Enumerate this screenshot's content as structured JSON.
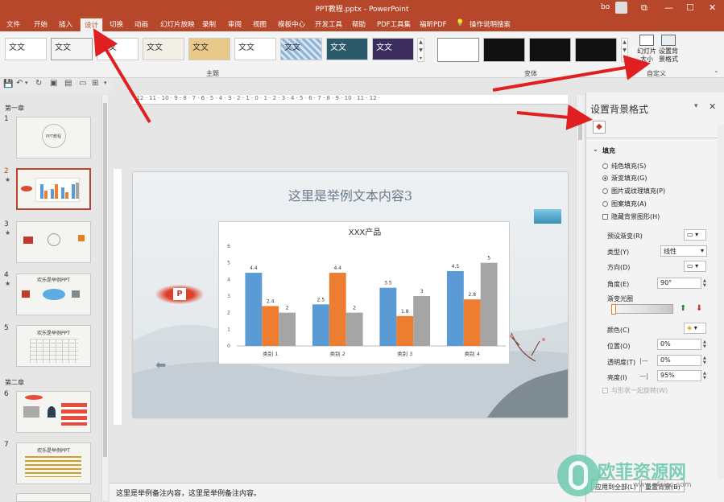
{
  "window": {
    "title": "PPT教程.pptx - PowerPoint",
    "user": "bo",
    "controls": [
      "⧉",
      "—",
      "☐",
      "✕"
    ]
  },
  "tabs": [
    "文件",
    "开始",
    "插入",
    "设计",
    "切换",
    "动画",
    "幻灯片放映",
    "录制",
    "审阅",
    "视图",
    "模板中心",
    "开发工具",
    "帮助",
    "PDF工具集",
    "福昕PDF",
    "操作说明搜索"
  ],
  "ribbon": {
    "themes_label": "主题",
    "variants_label": "变体",
    "custom_label": "自定义",
    "theme_thumb_text": "文文",
    "slide_size": "幻灯片\n大小",
    "format_bg": "设置背\n景格式"
  },
  "sections": [
    "第一章",
    "第二章"
  ],
  "slides": [
    "1",
    "2",
    "3",
    "4",
    "5",
    "6",
    "7"
  ],
  "slide_thumb_texts": {
    "s4": "欢乐是举例PPT",
    "s5": "欢乐是举例PPT",
    "s7": "欢乐是举例PPT",
    "s1": "PPT教程"
  },
  "slide": {
    "title": "这里是举例文本内容3"
  },
  "chart_data": {
    "type": "bar",
    "title": "XXX产品",
    "categories": [
      "类别 1",
      "类别 2",
      "类别 3",
      "类别 4"
    ],
    "series": [
      {
        "values": [
          4.4,
          2.5,
          3.5,
          4.5
        ],
        "color": "#5b9bd5"
      },
      {
        "values": [
          2.4,
          4.4,
          1.8,
          2.8
        ],
        "color": "#ed7d31"
      },
      {
        "values": [
          2,
          2,
          3,
          5
        ],
        "color": "#a5a5a5"
      }
    ],
    "ylim": [
      0,
      6
    ],
    "yticks": [
      "0",
      "1",
      "2",
      "3",
      "4",
      "5",
      "6"
    ],
    "grid": false
  },
  "notes": "这里是举例备注内容，这里是举例备注内容。",
  "panel": {
    "title": "设置背景格式",
    "fill_header": "填充",
    "options": [
      "纯色填充(S)",
      "渐变填充(G)",
      "图片或纹理填充(P)",
      "图案填充(A)"
    ],
    "selected_option": 1,
    "hide_bg": "隐藏背景图形(H)",
    "preset_label": "预设渐变(R)",
    "type_label": "类型(Y)",
    "type_value": "线性",
    "direction_label": "方向(D)",
    "angle_label": "角度(E)",
    "angle_value": "90°",
    "stops_label": "渐变光圈",
    "color_label": "颜色(C)",
    "position_label": "位置(O)",
    "position_value": "0%",
    "transparency_label": "透明度(T)",
    "transparency_value": "0%",
    "brightness_label": "亮度(I)",
    "brightness_value": "95%",
    "rotate_with_shape": "与形状一起旋转(W)",
    "apply_all": "应用到全部(L)",
    "reset_bg": "重置背景(B)"
  },
  "watermark": {
    "text": "欧菲资源网",
    "url": "www.ofeisc.com"
  }
}
